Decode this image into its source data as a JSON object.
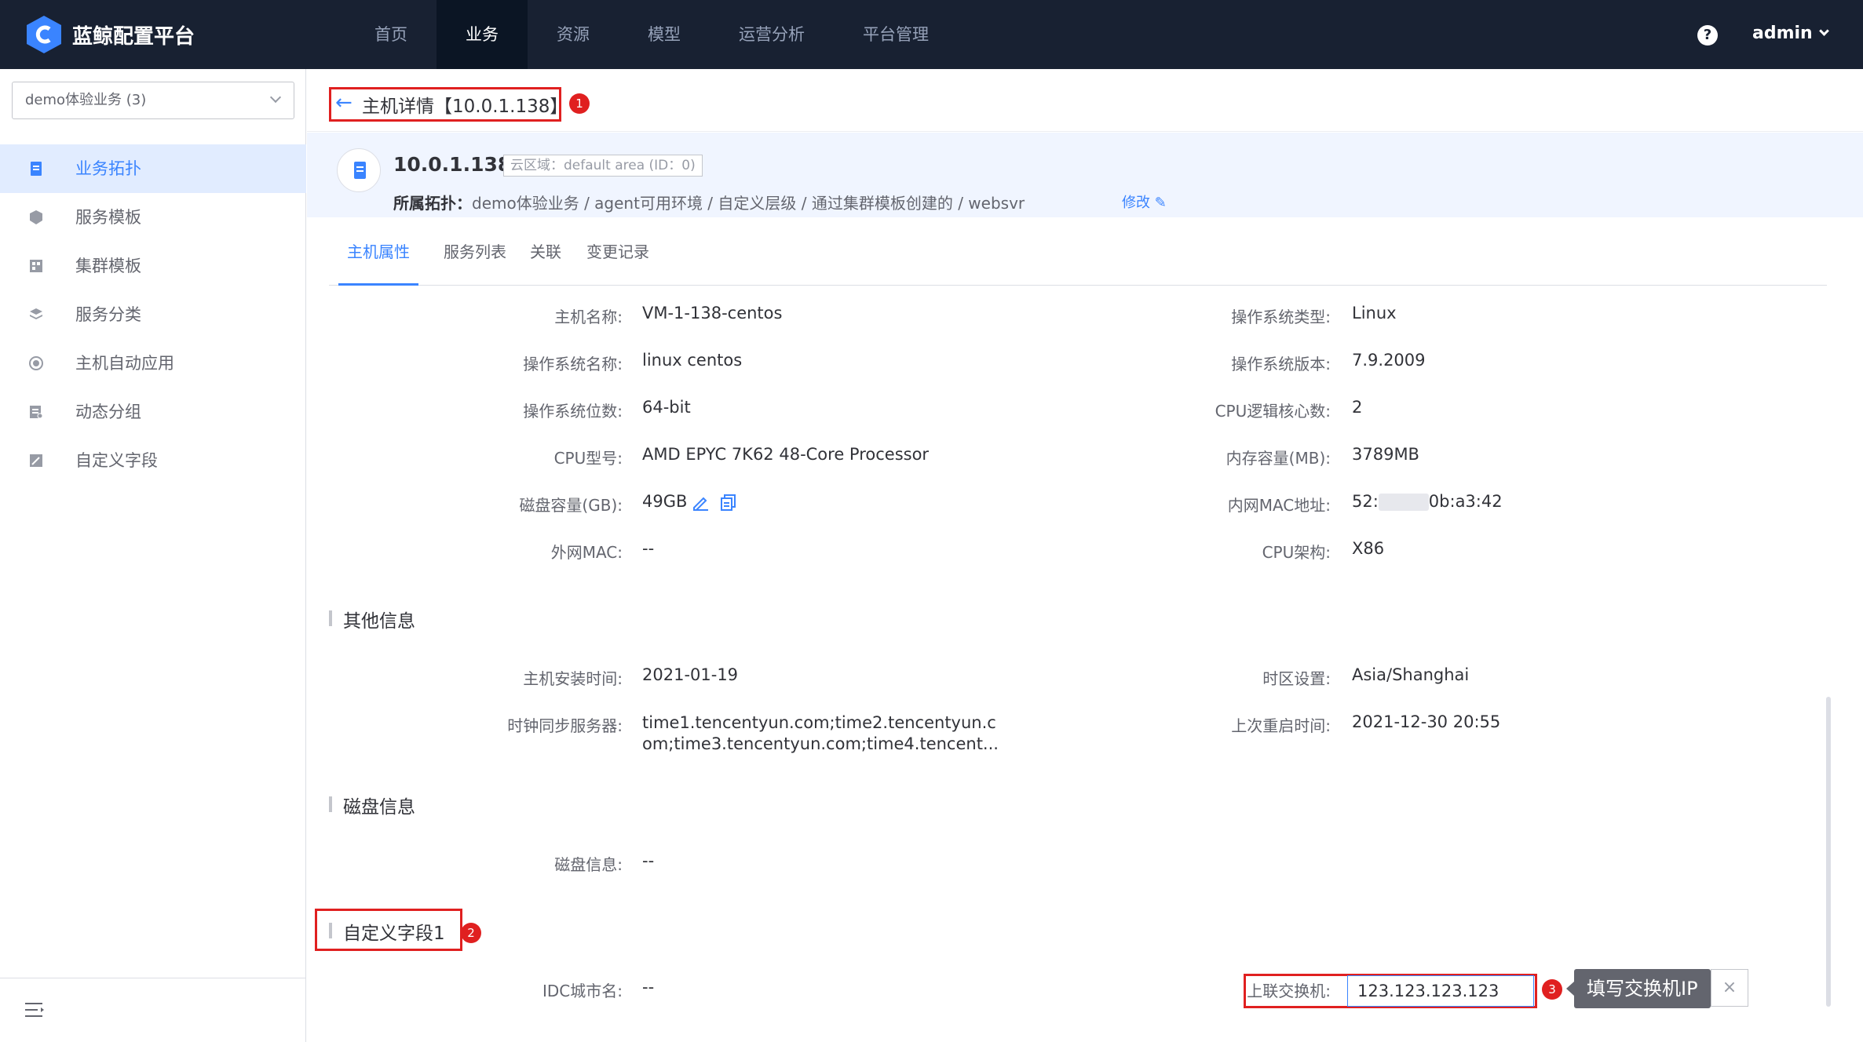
{
  "app": {
    "brand": "蓝鲸配置平台",
    "help_symbol": "?",
    "user": "admin"
  },
  "nav": [
    "首页",
    "业务",
    "资源",
    "模型",
    "运营分析",
    "平台管理"
  ],
  "sidebar": {
    "biz_select": "demo体验业务 (3)",
    "items": [
      "业务拓扑",
      "服务模板",
      "集群模板",
      "服务分类",
      "主机自动应用",
      "动态分组",
      "自定义字段"
    ]
  },
  "header": {
    "title": "主机详情【10.0.1.138】",
    "badge1": "1",
    "badge2": "2",
    "badge3": "3"
  },
  "host": {
    "ip": "10.0.1.138",
    "cloud_area": "云区域：default area (ID：0)",
    "topo_label": "所属拓扑：",
    "topo_path": "demo体验业务 / agent可用环境 / 自定义层级 / 通过集群模板创建的 / websvr",
    "edit": "修改"
  },
  "tabs": [
    "主机属性",
    "服务列表",
    "关联",
    "变更记录"
  ],
  "attrs": [
    {
      "l1": "主机名称:",
      "v1": "VM-1-138-centos",
      "l2": "操作系统类型:",
      "v2": "Linux"
    },
    {
      "l1": "操作系统名称:",
      "v1": "linux centos",
      "l2": "操作系统版本:",
      "v2": "7.9.2009"
    },
    {
      "l1": "操作系统位数:",
      "v1": "64-bit",
      "l2": "CPU逻辑核心数:",
      "v2": "2"
    },
    {
      "l1": "CPU型号:",
      "v1": "AMD EPYC 7K62 48-Core Processor",
      "l2": "内存容量(MB):",
      "v2": "3789MB"
    },
    {
      "l1": "磁盘容量(GB):",
      "v1": "49GB",
      "l2": "内网MAC地址:",
      "v2a": "52:",
      "v2b": "0b:a3:42"
    },
    {
      "l1": "外网MAC:",
      "v1": "--",
      "l2": "CPU架构:",
      "v2": "X86"
    }
  ],
  "other": {
    "title": "其他信息",
    "install_label": "主机安装时间:",
    "install_value": "2021-01-19",
    "tz_label": "时区设置:",
    "tz_value": "Asia/Shanghai",
    "ntp_label": "时钟同步服务器:",
    "ntp_line1": "time1.tencentyun.com;time2.tencentyun.c",
    "ntp_line2": "om;time3.tencentyun.com;time4.tencent...",
    "reboot_label": "上次重启时间:",
    "reboot_value": "2021-12-30 20:55"
  },
  "disk": {
    "title": "磁盘信息",
    "label": "磁盘信息:",
    "value": "--"
  },
  "custom": {
    "title": "自定义字段1",
    "idc_label": "IDC城市名:",
    "idc_value": "--",
    "switch_label": "上联交换机:",
    "switch_value": "123.123.123.123",
    "tooltip": "填写交换机IP",
    "close": "×"
  },
  "colors": {
    "accent": "#3a84ff",
    "topbar": "#182132",
    "highlight": "#e02020"
  }
}
